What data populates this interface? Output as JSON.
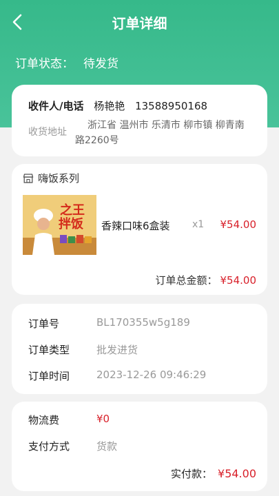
{
  "nav": {
    "title": "订单详细"
  },
  "status": {
    "label": "订单状态：",
    "value": "待发货"
  },
  "address": {
    "receiver_label": "收件人/电话",
    "receiver_name": "杨艳艳",
    "receiver_phone": "13588950168",
    "address_label": "收货地址",
    "address_line1": "浙江省 温州市 乐清市 柳市镇 柳青南",
    "address_line2": "路2260号"
  },
  "goods": {
    "shop_name": "嗨饭系列",
    "product_image_text": "之王 拌饭",
    "product_name": "香辣口味6盒装",
    "quantity": "x1",
    "price": "¥54.00",
    "total_label": "订单总金额：",
    "total_value": "¥54.00"
  },
  "order_info": {
    "order_no_label": "订单号",
    "order_no": "BL170355w5g189",
    "order_type_label": "订单类型",
    "order_type": "批发进货",
    "order_time_label": "订单时间",
    "order_time": "2023-12-26 09:46:29"
  },
  "payment": {
    "shipping_label": "物流费",
    "shipping_value": "¥0",
    "method_label": "支付方式",
    "method_value": "货款",
    "paid_label": "实付款：",
    "paid_value": "¥54.00"
  },
  "colors": {
    "accent": "#3cbc8f",
    "price": "#d8202a"
  }
}
